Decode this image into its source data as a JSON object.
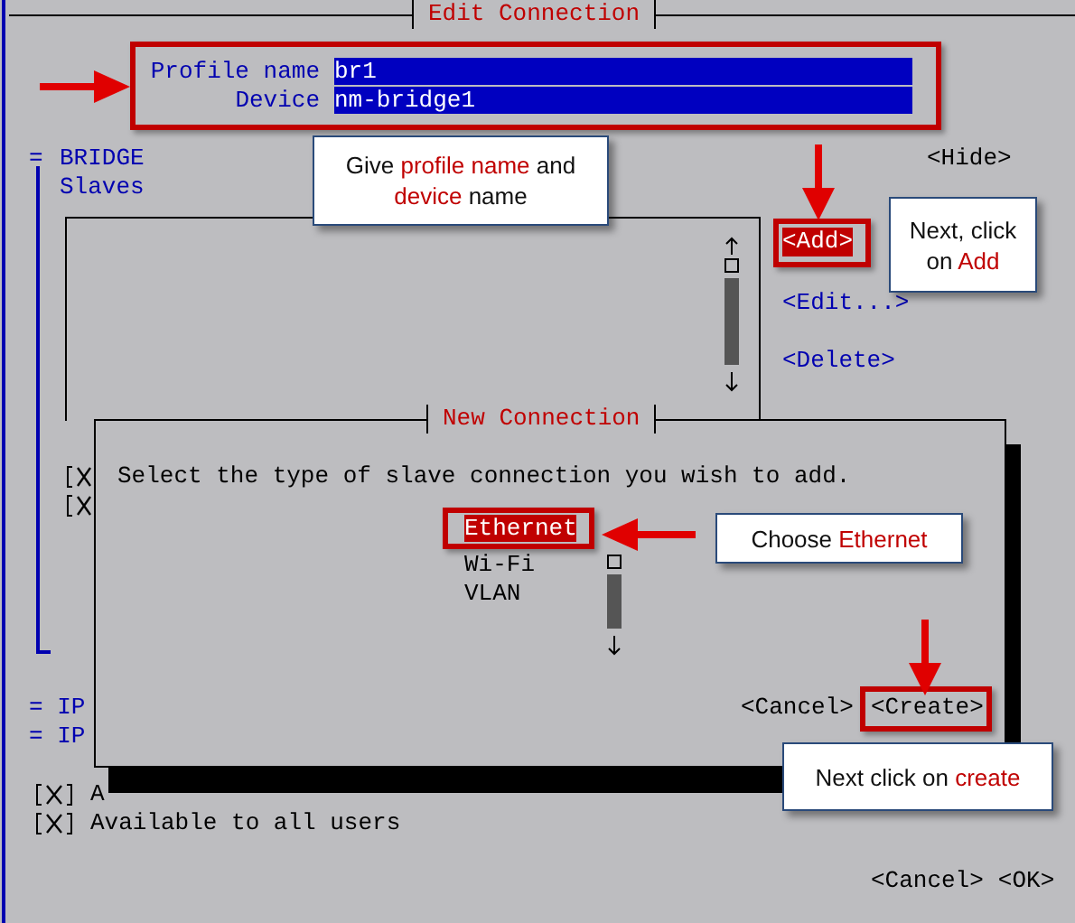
{
  "edit_connection": {
    "title": "Edit Connection",
    "fields": [
      {
        "label": "Profile name",
        "value": "br1"
      },
      {
        "label": "Device",
        "value": "nm-bridge1"
      }
    ],
    "section": {
      "marker": "=",
      "title": "BRIDGE",
      "toggle": "<Hide>"
    },
    "slaves": {
      "label": "Slaves",
      "buttons": [
        {
          "label": "<Add>",
          "selected": true
        },
        {
          "label": "<Edit...>",
          "selected": false
        },
        {
          "label": "<Delete>",
          "selected": false
        }
      ]
    },
    "hidden_rows": [
      {
        "checked": true
      },
      {
        "checked": true
      }
    ],
    "ip_sections": [
      {
        "marker": "=",
        "label": "IP"
      },
      {
        "marker": "=",
        "label": "IP"
      }
    ],
    "options": [
      {
        "checked": true,
        "label": "A"
      },
      {
        "checked": true,
        "label": "Available to all users"
      }
    ],
    "buttons": [
      "<Cancel>",
      "<OK>"
    ]
  },
  "new_connection": {
    "title": "New Connection",
    "prompt": "Select the type of slave connection you wish to add.",
    "types": [
      {
        "label": "Ethernet",
        "selected": true
      },
      {
        "label": "Wi-Fi",
        "selected": false
      },
      {
        "label": "VLAN",
        "selected": false
      }
    ],
    "buttons": [
      {
        "label": "<Cancel>",
        "selected": false
      },
      {
        "label": "<Create>",
        "selected": false
      }
    ]
  },
  "callouts": [
    {
      "kind": "fields",
      "parts": [
        {
          "text": "Give ",
          "highlight": false
        },
        {
          "text": "profile name",
          "highlight": true
        },
        {
          "text": " and ",
          "highlight": false
        },
        {
          "text": "device",
          "highlight": true
        },
        {
          "text": " name",
          "highlight": false
        }
      ]
    },
    {
      "kind": "add",
      "parts": [
        {
          "text": "Next, click on ",
          "highlight": false
        },
        {
          "text": "Add",
          "highlight": true
        }
      ]
    },
    {
      "kind": "type",
      "parts": [
        {
          "text": "Choose ",
          "highlight": false
        },
        {
          "text": "Ethernet",
          "highlight": true
        }
      ]
    },
    {
      "kind": "create",
      "parts": [
        {
          "text": "Next click on ",
          "highlight": false
        },
        {
          "text": "create",
          "highlight": true
        }
      ]
    }
  ]
}
